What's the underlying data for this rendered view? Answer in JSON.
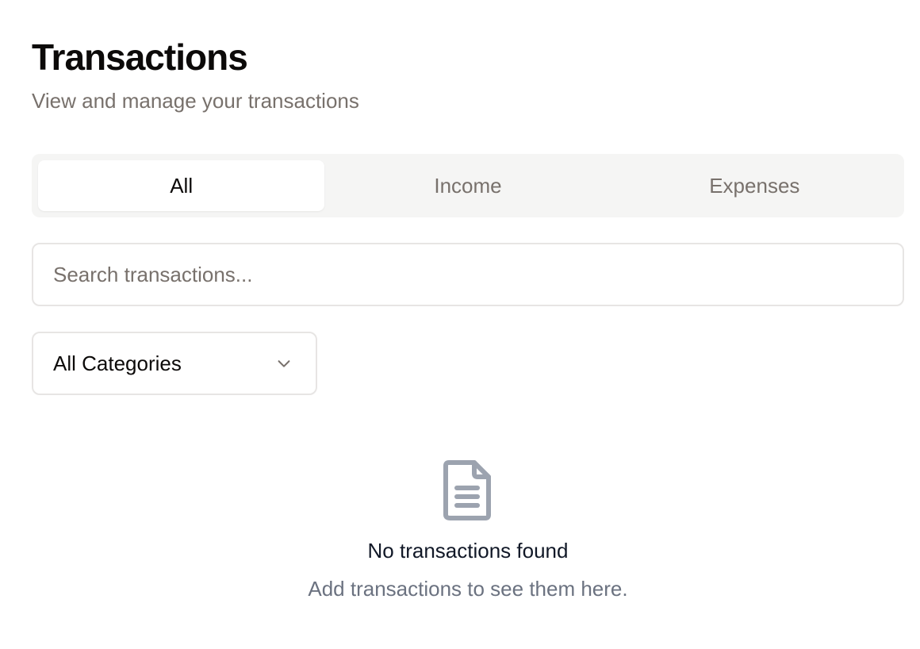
{
  "header": {
    "title": "Transactions",
    "subtitle": "View and manage your transactions"
  },
  "tabs": [
    {
      "label": "All",
      "active": true
    },
    {
      "label": "Income",
      "active": false
    },
    {
      "label": "Expenses",
      "active": false
    }
  ],
  "search": {
    "placeholder": "Search transactions...",
    "value": ""
  },
  "category_select": {
    "selected": "All Categories",
    "icon": "chevron-down-icon"
  },
  "empty_state": {
    "icon": "document-icon",
    "title": "No transactions found",
    "description": "Add transactions to see them here."
  },
  "colors": {
    "muted_text": "#78716c",
    "tab_bg": "#f5f5f4",
    "border": "#e7e5e4",
    "icon_gray": "#9ca3af"
  }
}
